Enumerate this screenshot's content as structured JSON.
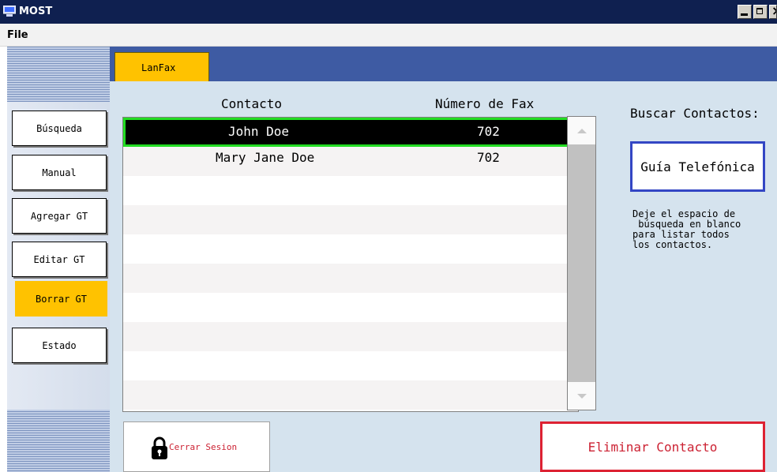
{
  "window": {
    "title": "MOST"
  },
  "menu": {
    "file": "File"
  },
  "sidebar": {
    "items": [
      {
        "label": "Búsqueda",
        "active": false
      },
      {
        "label": "Manual",
        "active": false
      },
      {
        "label": "Agregar GT",
        "active": false
      },
      {
        "label": "Editar GT",
        "active": false
      },
      {
        "label": "Borrar GT",
        "active": true
      },
      {
        "label": "Estado",
        "active": false
      }
    ]
  },
  "tabs": [
    {
      "label": "LanFax",
      "active": true
    }
  ],
  "table": {
    "headers": {
      "contact": "Contacto",
      "fax": "Número de Fax"
    },
    "rows": [
      {
        "contact": "John Doe",
        "fax": "702",
        "selected": true
      },
      {
        "contact": "Mary Jane Doe",
        "fax": "702",
        "selected": false
      }
    ]
  },
  "search": {
    "label": "Buscar Contactos:",
    "phonebook_button": "Guía Telefónica",
    "help": "Deje el espacio de\n búsqueda en blanco\npara listar todos\nlos contactos."
  },
  "actions": {
    "logout": "Cerrar Sesion",
    "delete": "Eliminar Contacto"
  },
  "colors": {
    "titlebar": "#0f2050",
    "tab_bar": "#3e5ba3",
    "accent_yellow": "#ffc200",
    "content_bg": "#d5e3ee",
    "selection_border": "#22dd22",
    "delete_red": "#dd2233",
    "phonebook_blue": "#3346c4"
  }
}
